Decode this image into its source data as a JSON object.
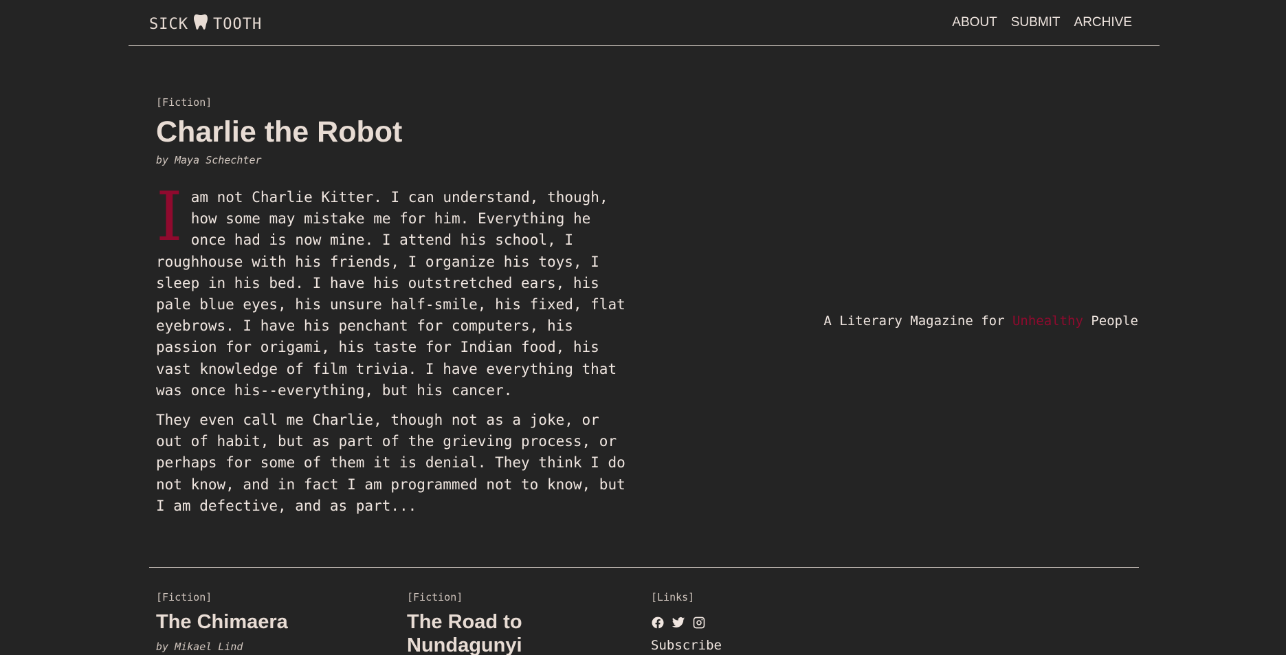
{
  "header": {
    "logo_left": "SICK",
    "logo_right": "TOOTH",
    "logo_icon": "tooth-icon",
    "nav": [
      {
        "label": "ABOUT"
      },
      {
        "label": "SUBMIT"
      },
      {
        "label": "ARCHIVE"
      }
    ]
  },
  "featured": {
    "category": "[Fiction]",
    "title": "Charlie the Robot",
    "byline": "by Maya Schechter",
    "dropcap": "I",
    "paragraphs": [
      "am not Charlie Kitter. I can understand, though, how some may mistake me for him. Everything he once had is now mine. I attend his school, I roughhouse with his friends, I organize his toys, I sleep in his bed. I have his outstretched ears, his pale blue eyes, his unsure half-smile, his fixed, flat eyebrows. I have his penchant for computers, his passion for origami, his taste for Indian food, his vast knowledge of film trivia. I have everything that was once his--everything, but his cancer.",
      "They even call me Charlie, though not as a joke, or out of habit, but as part of the grieving process, or perhaps for some of them it is denial. They think I do not know, and in fact I am programmed not to know, but I am defective, and as part..."
    ]
  },
  "tagline": {
    "before": "A Literary Magazine for ",
    "accent": "Unhealthy",
    "after": " People"
  },
  "cards": [
    {
      "category": "[Fiction]",
      "title": "The Chimaera",
      "byline": "by Mikael Lind"
    },
    {
      "category": "[Fiction]",
      "title": "The Road to Nundagunyi",
      "byline": ""
    },
    {
      "category": "[Links]",
      "subscribe": "Subscribe",
      "icons": [
        "facebook-icon",
        "twitter-icon",
        "instagram-icon"
      ]
    }
  ],
  "colors": {
    "background": "#242424",
    "accent": "#8f0a2e",
    "text": "#e8dcd4"
  }
}
